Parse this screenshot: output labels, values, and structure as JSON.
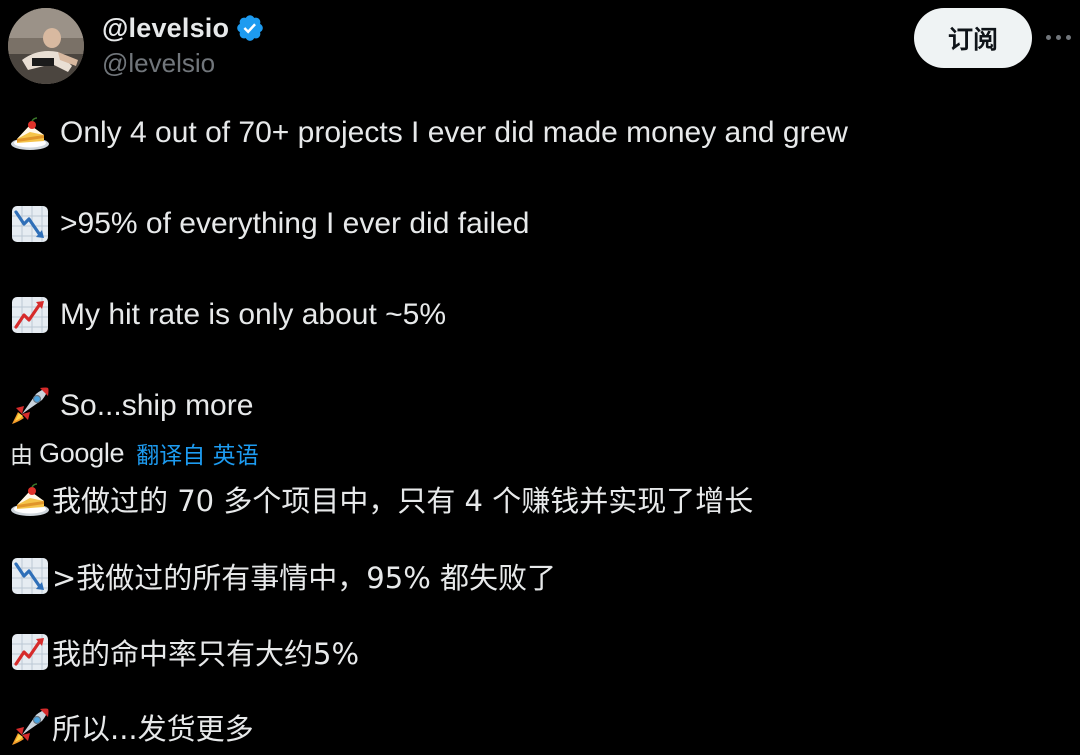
{
  "author": {
    "display_name": "@levelsio",
    "handle": "@levelsio",
    "verified": true,
    "avatar_icon": "avatar-photo"
  },
  "actions": {
    "subscribe_label": "订阅",
    "more_icon": "more-horizontal-icon"
  },
  "post": {
    "lines": [
      {
        "icon": "cake-emoji",
        "text": "Only 4 out of 70+ projects I ever did made money and grew"
      },
      {
        "icon": "chart-decreasing-emoji",
        "text": ">95% of everything I ever did failed"
      },
      {
        "icon": "chart-increasing-emoji",
        "text": "My hit rate is only about ~5%"
      },
      {
        "icon": "rocket-emoji",
        "text": "So...ship more"
      }
    ]
  },
  "translation": {
    "by_label": "由",
    "provider": "Google",
    "translated_from": "翻译自 英语",
    "lines": [
      {
        "icon": "cake-emoji",
        "text": "我做过的 70 多个项目中，只有 4 个赚钱并实现了增长"
      },
      {
        "icon": "chart-decreasing-emoji",
        "text": " >我做过的所有事情中，95% 都失败了"
      },
      {
        "icon": "chart-increasing-emoji",
        "text": "我的命中率只有大约5%"
      },
      {
        "icon": "rocket-emoji",
        "text": "所以...发货更多"
      }
    ]
  },
  "colors": {
    "background": "#000000",
    "primary_text": "#e7e9ea",
    "secondary_text": "#71767b",
    "accent": "#1d9bf0",
    "button_bg": "#eff3f4"
  }
}
